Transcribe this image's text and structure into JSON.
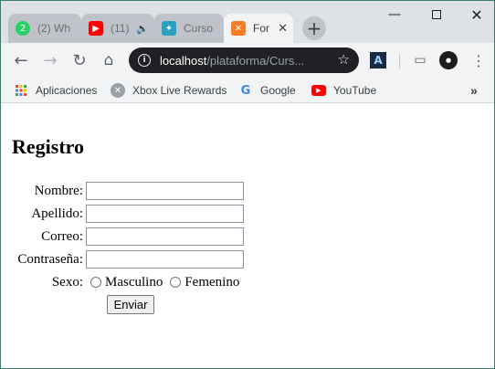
{
  "browser": {
    "tabs": [
      {
        "title": "(2) Wh",
        "icon": "whatsapp-icon",
        "color": "#25d366",
        "icon_text": "2"
      },
      {
        "title": "(11)",
        "icon": "youtube-icon",
        "color": "#ff0000"
      },
      {
        "title": "Curso",
        "icon": "course-site-icon",
        "color": "#2aa1c0"
      },
      {
        "title": "For",
        "icon": "xampp-icon",
        "color": "#fb7a24"
      }
    ],
    "new_tab_label": "+",
    "address": {
      "host": "localhost",
      "path": "/plataforma/Curs..."
    },
    "bookmarks": [
      {
        "label": "Aplicaciones",
        "icon": "apps-grid-icon"
      },
      {
        "label": "Xbox Live Rewards",
        "icon": "xbox-icon"
      },
      {
        "label": "Google",
        "icon": "google-icon"
      },
      {
        "label": "YouTube",
        "icon": "youtube-icon"
      }
    ],
    "bookmarks_overflow": "»"
  },
  "page": {
    "title": "Registro",
    "form": {
      "nombre_label": "Nombre:",
      "apellido_label": "Apellido:",
      "correo_label": "Correo:",
      "contrasena_label": "Contraseña:",
      "sexo_label": "Sexo:",
      "masculino_label": "Masculino",
      "femenino_label": "Femenino",
      "submit_label": "Enviar"
    }
  }
}
